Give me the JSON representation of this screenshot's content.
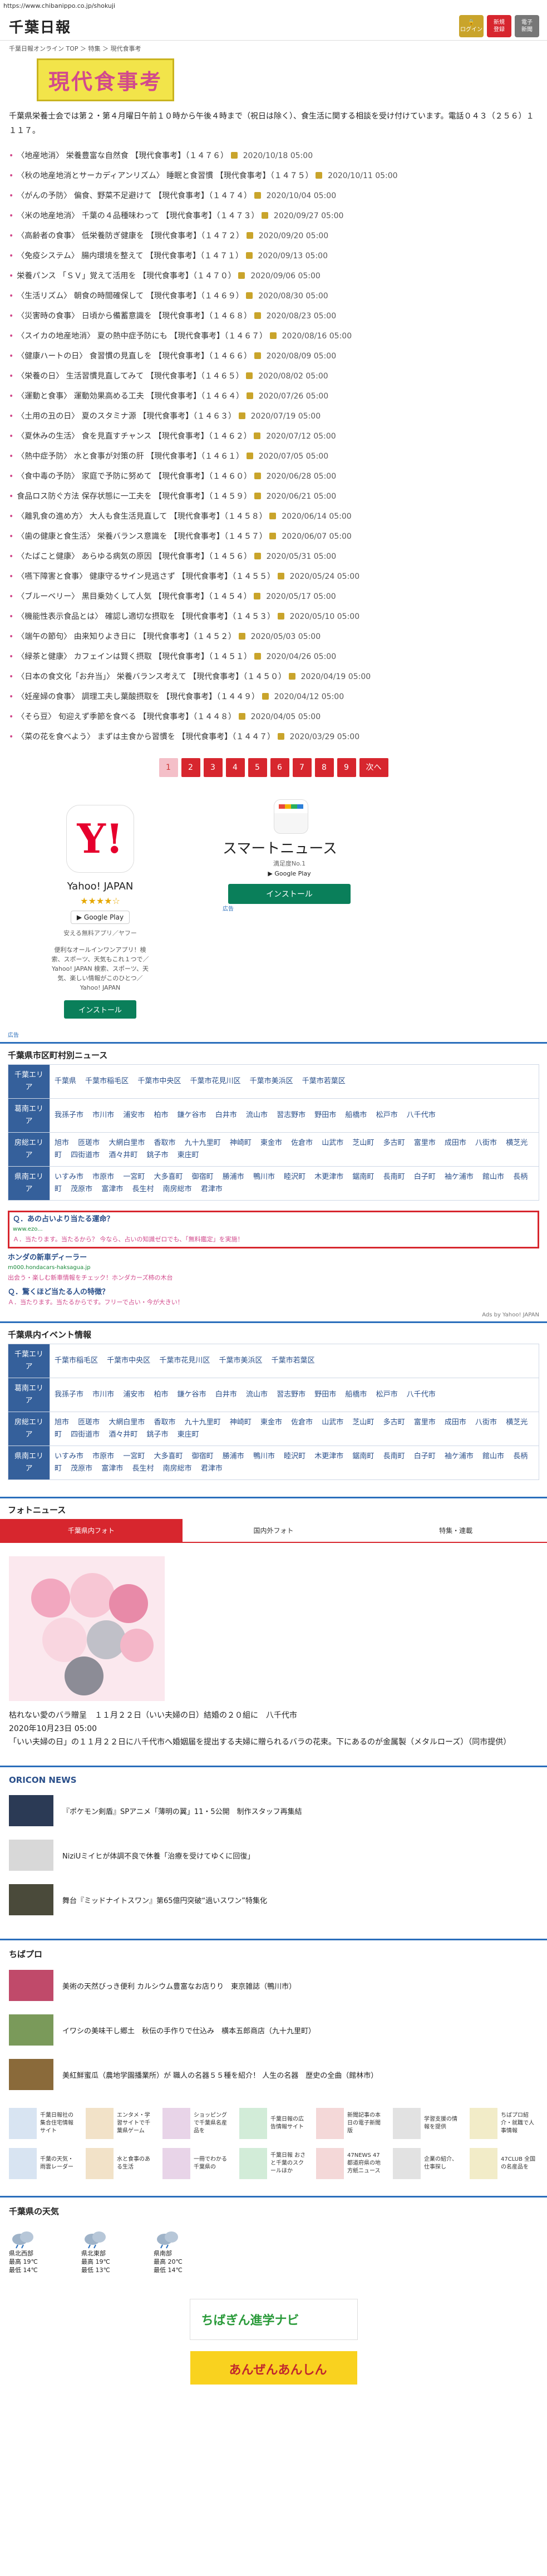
{
  "url": "https://www.chibanippo.co.jp/shokuji",
  "header": {
    "logo": "千葉日報",
    "btn_login": [
      "ログイン",
      ""
    ],
    "btn_register": [
      "新規",
      "登録"
    ],
    "btn_epaper": [
      "電子",
      "新聞"
    ]
  },
  "breadcrumb": "千葉日報オンライン TOP ＞ 特集 ＞ 現代食事考",
  "title": "現代食事考",
  "intro": "千葉県栄養士会では第２・第４月曜日午前１０時から午後４時まで（祝日は除く）、食生活に関する相談を受け付けています。電話０４３（２５６）１１１７。",
  "articles": [
    {
      "t": "〈地産地消〉 栄養豊富な自然食 【現代食事考】（１４７６）",
      "d": "2020/10/18 05:00"
    },
    {
      "t": "〈秋の地産地消とサーカディアンリズム〉 睡眠と食習慣 【現代食事考】（１４７５）",
      "d": "2020/10/11 05:00"
    },
    {
      "t": "〈がんの予防〉 偏食、野菜不足避けて 【現代食事考】（１４７４）",
      "d": "2020/10/04 05:00"
    },
    {
      "t": "〈米の地産地消〉 千葉の４品種味わって 【現代食事考】（１４７３）",
      "d": "2020/09/27 05:00"
    },
    {
      "t": "〈高齢者の食事〉 低栄養防ぎ健康を 【現代食事考】（１４７２）",
      "d": "2020/09/20 05:00"
    },
    {
      "t": "〈免疫システム〉 腸内環境を整えて 【現代食事考】（１４７１）",
      "d": "2020/09/13 05:00"
    },
    {
      "t": "栄養パンス 「ＳＶ」覚えて活用を 【現代食事考】（１４７０）",
      "d": "2020/09/06 05:00"
    },
    {
      "t": "〈生活リズム〉 朝食の時間確保して 【現代食事考】（１４６９）",
      "d": "2020/08/30 05:00"
    },
    {
      "t": "〈災害時の食事〉 日頃から備蓄意識を 【現代食事考】（１４６８）",
      "d": "2020/08/23 05:00"
    },
    {
      "t": "〈スイカの地産地消〉 夏の熱中症予防にも 【現代食事考】（１４６７）",
      "d": "2020/08/16 05:00"
    },
    {
      "t": "〈健康ハートの日〉 食習慣の見直しを 【現代食事考】（１４６６）",
      "d": "2020/08/09 05:00"
    },
    {
      "t": "〈栄養の日〉 生活習慣見直してみて 【現代食事考】（１４６５）",
      "d": "2020/08/02 05:00"
    },
    {
      "t": "〈運動と食事〉 運動効果高める工夫 【現代食事考】（１４６４）",
      "d": "2020/07/26 05:00"
    },
    {
      "t": "〈土用の丑の日〉 夏のスタミナ源 【現代食事考】（１４６３）",
      "d": "2020/07/19 05:00"
    },
    {
      "t": "〈夏休みの生活〉 食を見直すチャンス 【現代食事考】（１４６２）",
      "d": "2020/07/12 05:00"
    },
    {
      "t": "〈熱中症予防〉 水と食事が対策の肝 【現代食事考】（１４６１）",
      "d": "2020/07/05 05:00"
    },
    {
      "t": "〈食中毒の予防〉 家庭で予防に努めて 【現代食事考】（１４６０）",
      "d": "2020/06/28 05:00"
    },
    {
      "t": "食品ロス防ぐ方法 保存状態に一工夫を 【現代食事考】（１４５９）",
      "d": "2020/06/21 05:00"
    },
    {
      "t": "〈離乳食の進め方〉 大人も食生活見直して 【現代食事考】（１４５８）",
      "d": "2020/06/14 05:00"
    },
    {
      "t": "〈歯の健康と食生活〉 栄養バランス意識を 【現代食事考】（１４５７）",
      "d": "2020/06/07 05:00"
    },
    {
      "t": "〈たばこと健康〉 あらゆる病気の原因 【現代食事考】（１４５６）",
      "d": "2020/05/31 05:00"
    },
    {
      "t": "〈嚥下障害と食事〉 健康守るサイン見逃さず 【現代食事考】（１４５５）",
      "d": "2020/05/24 05:00"
    },
    {
      "t": "〈ブルーベリー〉 黒目乗効くして人気 【現代食事考】（１４５４）",
      "d": "2020/05/17 05:00"
    },
    {
      "t": "〈機能性表示食品とは〉 確認し適切な摂取を 【現代食事考】（１４５３）",
      "d": "2020/05/10 05:00"
    },
    {
      "t": "〈端午の節句〉 由来知りよき日に 【現代食事考】（１４５２）",
      "d": "2020/05/03 05:00"
    },
    {
      "t": "〈緑茶と健康〉 カフェインは賢く摂取 【現代食事考】（１４５１）",
      "d": "2020/04/26 05:00"
    },
    {
      "t": "〈日本の食文化「お弁当」〉 栄養バランス考えて 【現代食事考】（１４５０）",
      "d": "2020/04/19 05:00"
    },
    {
      "t": "〈妊産婦の食事〉 調理工夫し葉酸摂取を 【現代食事考】（１４４９）",
      "d": "2020/04/12 05:00"
    },
    {
      "t": "〈そら豆〉 旬迎えず季節を食べる 【現代食事考】（１４４８）",
      "d": "2020/04/05 05:00"
    },
    {
      "t": "〈菜の花を食べよう〉 まずは主食から習慣を 【現代食事考】（１４４７）",
      "d": "2020/03/29 05:00"
    }
  ],
  "pager": [
    "1",
    "2",
    "3",
    "4",
    "5",
    "6",
    "7",
    "8",
    "9",
    "次へ"
  ],
  "ad_yahoo": {
    "icon": "Y!",
    "name": "Yahoo! JAPAN",
    "stars": "★★★★☆",
    "gplay": "▶ Google Play",
    "small": "安える無料アプリ／ヤフー",
    "desc": "便利なオールインワンアプリ！検索、スポーツ、天気もこれ１つで／Yahoo! JAPAN 検索、スポーツ、天気、楽しい情報がこのひとつ／Yahoo! JAPAN",
    "install": "インストール"
  },
  "ad_smartnews": {
    "name": "スマートニュース",
    "sub": "満足度No.1",
    "gplay": "▶ Google Play",
    "install": "インストール"
  },
  "ad_label": "広告",
  "municipal": {
    "title": "千葉県市区町村別ニュース",
    "rows": [
      {
        "label": "千葉エリア",
        "items": [
          "千葉県",
          "千葉市稲毛区",
          "千葉市中央区",
          "千葉市花見川区",
          "千葉市美浜区",
          "千葉市若葉区"
        ]
      },
      {
        "label": "葛南エリア",
        "items": [
          "我孫子市",
          "市川市",
          "浦安市",
          "柏市",
          "鎌ケ谷市",
          "白井市",
          "流山市",
          "習志野市",
          "野田市",
          "船橋市",
          "松戸市",
          "八千代市"
        ]
      },
      {
        "label": "房総エリア",
        "items": [
          "旭市",
          "匝瑳市",
          "大網白里市",
          "香取市",
          "九十九里町",
          "神崎町",
          "東金市",
          "佐倉市",
          "山武市",
          "芝山町",
          "多古町",
          "富里市",
          "成田市",
          "八街市",
          "横芝光町",
          "四街道市",
          "酒々井町",
          "銚子市",
          "東庄町"
        ]
      },
      {
        "label": "県南エリア",
        "items": [
          "いすみ市",
          "市原市",
          "一宮町",
          "大多喜町",
          "御宿町",
          "勝浦市",
          "鴨川市",
          "睦沢町",
          "木更津市",
          "鋸南町",
          "長南町",
          "白子町",
          "袖ケ浦市",
          "館山市",
          "長柄町",
          "茂原市",
          "富津市",
          "長生村",
          "南房総市",
          "君津市"
        ]
      }
    ]
  },
  "adlinks": [
    {
      "title": "Ｑ．あの占いより当たる運命？",
      "site": "www.ezo...",
      "text": "Ａ．当たります。当たるから？ 今なら、占いの知識ゼロでも、「無料鑑定」を実施！"
    },
    {
      "title": "ホンダの新車ディーラー",
      "site": "m000.hondacars-haksagua.jp",
      "text": "出会う・楽しむ新車情報をチェック！ホンダカーズ柿の木台"
    },
    {
      "title": "Ｑ．驚くほど当たる人の特徴？",
      "site": "",
      "text": "Ａ．当たります。当たるからです。フリーで占い・今が大きい！"
    }
  ],
  "ads_by": "Ads by Yahoo! JAPAN",
  "events": {
    "title": "千葉県内イベント情報",
    "rows": [
      {
        "label": "千葉エリア",
        "items": [
          "千葉市稲毛区",
          "千葉市中央区",
          "千葉市花見川区",
          "千葉市美浜区",
          "千葉市若葉区"
        ]
      },
      {
        "label": "葛南エリア",
        "items": [
          "我孫子市",
          "市川市",
          "浦安市",
          "柏市",
          "鎌ケ谷市",
          "白井市",
          "流山市",
          "習志野市",
          "野田市",
          "船橋市",
          "松戸市",
          "八千代市"
        ]
      },
      {
        "label": "房総エリア",
        "items": [
          "旭市",
          "匝瑳市",
          "大網白里市",
          "香取市",
          "九十九里町",
          "神崎町",
          "東金市",
          "佐倉市",
          "山武市",
          "芝山町",
          "多古町",
          "富里市",
          "成田市",
          "八街市",
          "横芝光町",
          "四街道市",
          "酒々井町",
          "銚子市",
          "東庄町"
        ]
      },
      {
        "label": "県南エリア",
        "items": [
          "いすみ市",
          "市原市",
          "一宮町",
          "大多喜町",
          "御宿町",
          "勝浦市",
          "鴨川市",
          "睦沢町",
          "木更津市",
          "鋸南町",
          "長南町",
          "白子町",
          "袖ケ浦市",
          "館山市",
          "長柄町",
          "茂原市",
          "富津市",
          "長生村",
          "南房総市",
          "君津市"
        ]
      }
    ]
  },
  "photonews": {
    "title": "フォトニュース",
    "tabs": [
      "千葉県内フォト",
      "国内外フォト",
      "特集・連載"
    ],
    "caption": "枯れない愛のバラ贈呈　１１月２２日（いい夫婦の日）結婚の２０組に　八千代市",
    "date": "2020年10月23日 05:00",
    "body": "「いい夫婦の日」の１１月２２日に八千代市へ婚姻届を提出する夫婦に贈られるバラの花束。下にあるのが金属製（メタルローズ）（同市提供）"
  },
  "oricon": {
    "title": "ORICON NEWS",
    "items": [
      "『ポケモン剣盾』SPアニメ「薄明の翼」11・5公開　制作スタッフ再集結",
      "NiziUミイヒが体調不良で休養「治療を受けてゆくに回復」",
      "舞台『ミッドナイトスワン』第65億円突破“過いスワン”特集化"
    ]
  },
  "chibapro": {
    "title": "ちばプロ",
    "items": [
      "美術の天然びっき便利 カルシウム豊富なお店りり　東京雑誌（鴨川市）",
      "イワシの美味干し郷土　秋伝の手作りで仕込み　横本五郎商店（九十九里町）",
      "美紅鮮蜜瓜（農地学園播業所）が 職人の名器５５種を紹介！ 人生の名器　歴史の全曲（館林市）"
    ],
    "grid": [
      "千葉日報社の集合住宅情報サイト",
      "エンタメ・学習サイトで千葉県ゲーム",
      "ショッピングで千葉県名産品を",
      "千葉日報の広告情報サイト",
      "新聞記事の本日の電子新聞版",
      "学習支援の情報を提供",
      "ちばプロ紹介・就職で人事情報",
      "千葉の天気・雨雲レーダー",
      "水と食事のある生活",
      "一冊でわかる千葉県の",
      "千葉日報 おさと千葉のスクールほか",
      "47NEWS 47都道府県の地方紙ニュース",
      "企業の紹介、仕事探し",
      "47CLUB 全国の名産品を"
    ]
  },
  "weather": {
    "title": "千葉県の天気",
    "items": [
      {
        "area": "県北西部",
        "temp": "最高 19℃",
        "low": "最低 14℃"
      },
      {
        "area": "県北東部",
        "temp": "最高 19℃",
        "low": "最低 13℃"
      },
      {
        "area": "県南部",
        "temp": "最高 20℃",
        "low": "最低 14℃"
      }
    ]
  },
  "bottom_ad": {
    "a": "ちばぎん進学ナビ",
    "b": "あんぜんあんしん"
  }
}
